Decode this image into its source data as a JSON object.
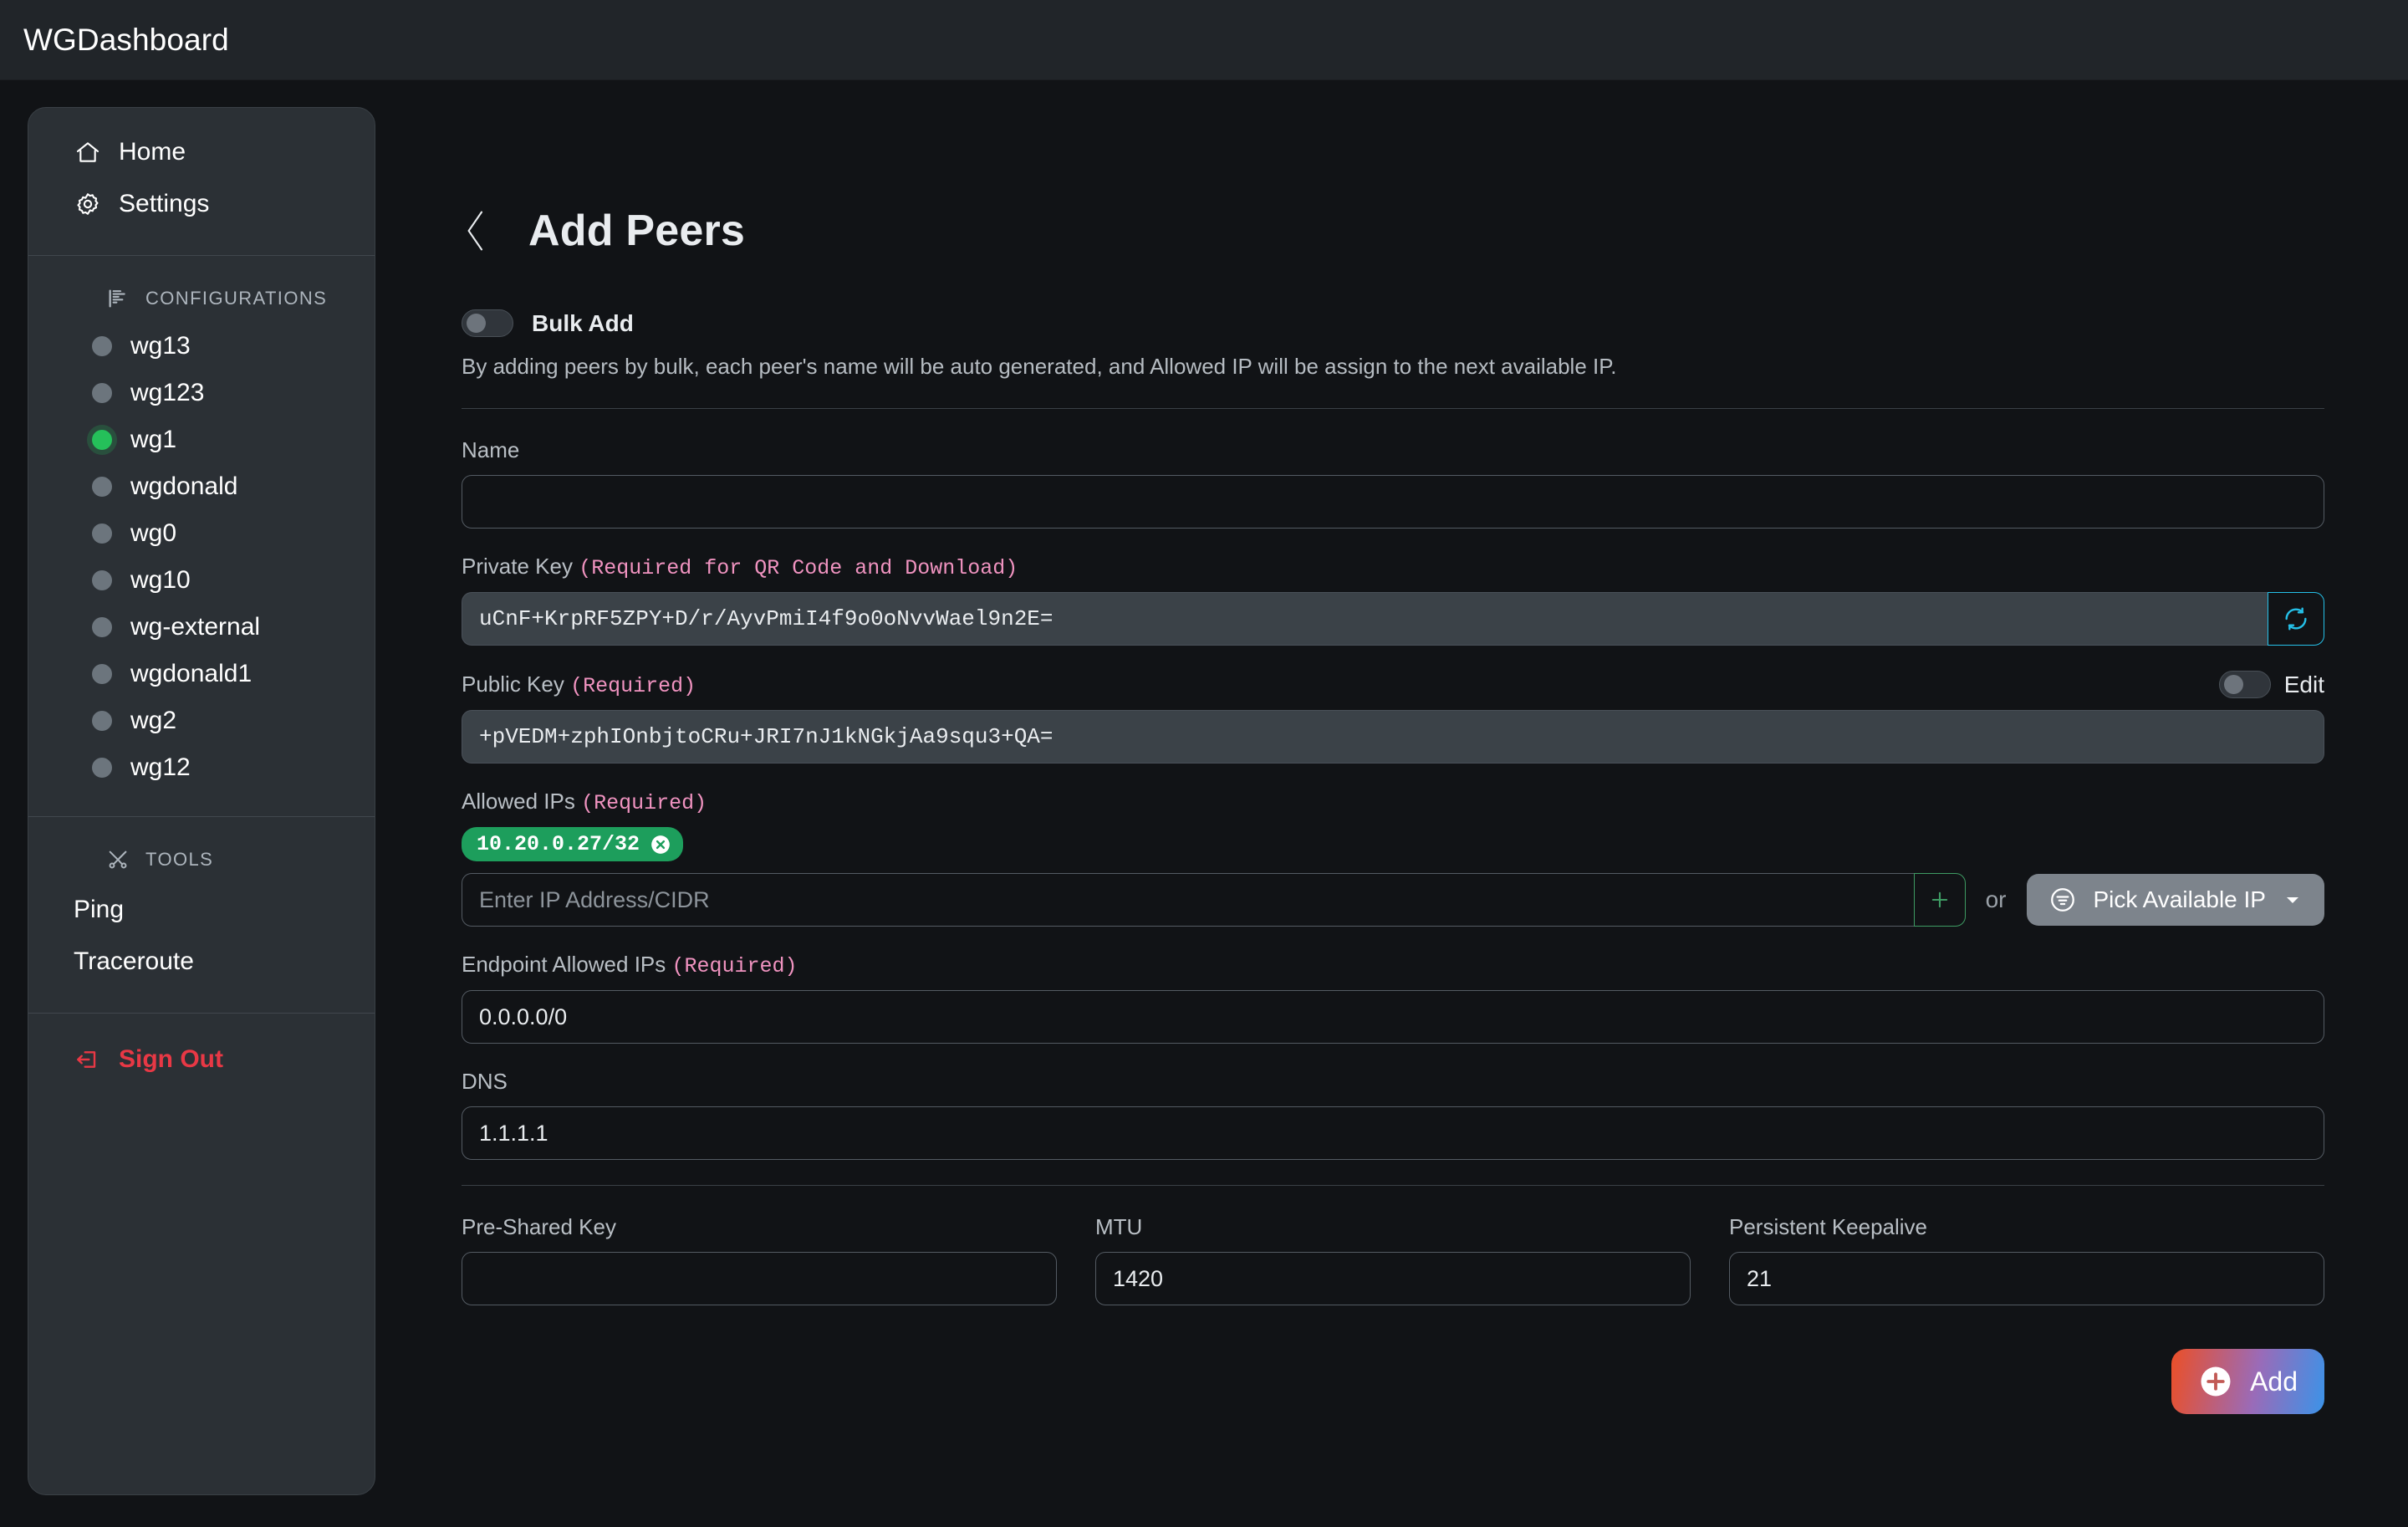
{
  "header": {
    "brand": "WGDashboard"
  },
  "sidebar": {
    "nav": [
      {
        "label": "Home",
        "icon": "home-icon"
      },
      {
        "label": "Settings",
        "icon": "gear-icon"
      }
    ],
    "configurations_heading": "CONFIGURATIONS",
    "configurations_icon": "signal-flag-icon",
    "configurations": [
      {
        "name": "wg13",
        "status": "inactive"
      },
      {
        "name": "wg123",
        "status": "inactive"
      },
      {
        "name": "wg1",
        "status": "active"
      },
      {
        "name": "wgdonald",
        "status": "inactive"
      },
      {
        "name": "wg0",
        "status": "inactive"
      },
      {
        "name": "wg10",
        "status": "inactive"
      },
      {
        "name": "wg-external",
        "status": "inactive"
      },
      {
        "name": "wgdonald1",
        "status": "inactive"
      },
      {
        "name": "wg2",
        "status": "inactive"
      },
      {
        "name": "wg12",
        "status": "inactive"
      }
    ],
    "tools_heading": "TOOLS",
    "tools_icon": "tools-icon",
    "tools": [
      {
        "label": "Ping"
      },
      {
        "label": "Traceroute"
      }
    ],
    "sign_out": {
      "label": "Sign Out",
      "icon": "sign-out-icon",
      "color": "#e83845"
    }
  },
  "main": {
    "back_icon": "chevron-left-icon",
    "title": "Add Peers",
    "bulk_add": {
      "label": "Bulk Add",
      "enabled": false,
      "description": "By adding peers by bulk, each peer's name will be auto generated, and Allowed IP will be assign to the next available IP."
    },
    "fields": {
      "name": {
        "label": "Name",
        "value": "",
        "placeholder": ""
      },
      "private_key": {
        "label": "Private Key",
        "required_note": "(Required for QR Code and Download)",
        "value": "uCnF+KrpRF5ZPY+D/r/AyvPmiI4f9o0oNvvWael9n2E=",
        "refresh_icon": "refresh-icon"
      },
      "public_key": {
        "label": "Public Key",
        "required_note": "(Required)",
        "value": "+pVEDM+zphIOnbjtoCRu+JRI7nJ1kNGkjAa9squ3+QA=",
        "edit_label": "Edit",
        "edit_enabled": false
      },
      "allowed_ips": {
        "label": "Allowed IPs",
        "required_note": "(Required)",
        "chips": [
          {
            "value": "10.20.0.27/32",
            "remove_icon": "close-circle-icon"
          }
        ],
        "placeholder": "Enter IP Address/CIDR",
        "value": "",
        "add_icon": "plus-icon",
        "or_text": "or",
        "pick_button": {
          "label": "Pick Available IP",
          "icon": "filter-circle-icon",
          "caret": "chevron-down-icon"
        }
      },
      "endpoint_allowed_ips": {
        "label": "Endpoint Allowed IPs",
        "required_note": "(Required)",
        "value": "0.0.0.0/0"
      },
      "dns": {
        "label": "DNS",
        "value": "1.1.1.1"
      },
      "pre_shared_key": {
        "label": "Pre-Shared Key",
        "value": ""
      },
      "mtu": {
        "label": "MTU",
        "value": "1420"
      },
      "persistent_keepalive": {
        "label": "Persistent Keepalive",
        "value": "21"
      }
    },
    "add_button": {
      "label": "Add",
      "icon": "plus-circle-icon"
    }
  },
  "colors": {
    "accent_green": "#25c05a",
    "accent_cyan": "#25c0e8",
    "required_pink": "#f093c0",
    "danger_red": "#e83845",
    "chip_green": "#1d9e5c"
  }
}
